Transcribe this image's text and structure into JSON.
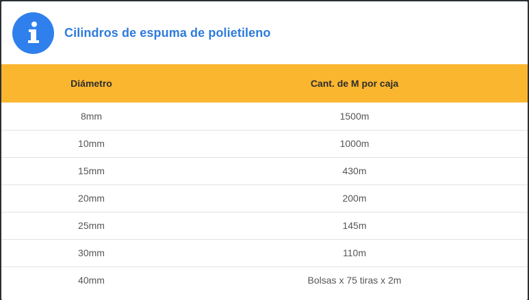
{
  "modal": {
    "title": "Cilindros de espuma de polietileno",
    "icon": "info-icon",
    "accent_color": "#2f80ed",
    "header_row_color": "#fbb62f"
  },
  "table": {
    "headers": [
      "Diámetro",
      "Cant. de M por caja"
    ],
    "rows": [
      [
        "8mm",
        "1500m"
      ],
      [
        "10mm",
        "1000m"
      ],
      [
        "15mm",
        "430m"
      ],
      [
        "20mm",
        "200m"
      ],
      [
        "25mm",
        "145m"
      ],
      [
        "30mm",
        "110m"
      ],
      [
        "40mm",
        "Bolsas x 75 tiras x 2m"
      ]
    ]
  }
}
